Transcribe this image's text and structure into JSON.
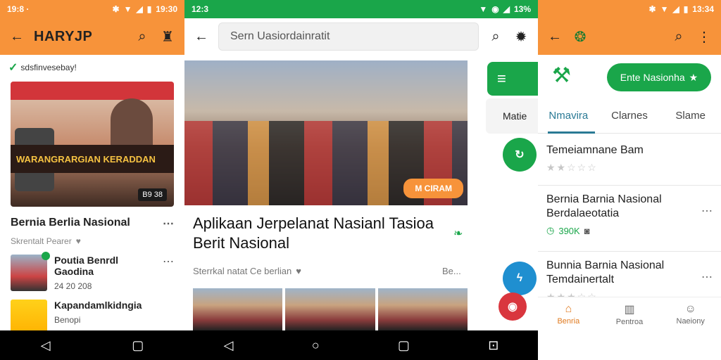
{
  "panel_a": {
    "status_time": "19:8 ·",
    "status_right": "19:30",
    "app_title": "HARYJP",
    "verified_text": "sdsfinvesebay!",
    "hero_banner": "WARANGRARGIAN KERADDAN",
    "hero_tag": "B9 38",
    "section_title": "Bernia Berlia Nasional",
    "meta_text": "Skrentalt Pearer",
    "items": [
      {
        "title": "Poutia Benrdl Gaodina",
        "sub": "24 20 208"
      },
      {
        "title": "Kapandamlkidngia",
        "sub": "Benopi"
      }
    ]
  },
  "panel_b": {
    "status_time": "12:3",
    "status_right": "13%",
    "search_placeholder": "Sern Uasiordainratit",
    "hero_pill": "M CIRAM",
    "side_label": "Matie",
    "title": "Aplikaan Jerpelanat Nasianl Tasioa Berit Nasional",
    "meta_text": "Sterrkal natat  Ce berlian",
    "more_text": "Be..."
  },
  "panel_c": {
    "status_right": "13:34",
    "cta_label": "Ente Nasionha",
    "tabs": [
      "Nmavira",
      "Clarnes",
      "Slame"
    ],
    "items": [
      {
        "title": "Temeiamnane Bam"
      },
      {
        "title": "Bernia Barnia Nasional Berdalaeotatia",
        "sub": "390K"
      },
      {
        "title": "Bunnia Barnia Nasional Temdainertalt"
      }
    ],
    "bottom_nav": [
      "Benria",
      "Pentroa",
      "Naeiony"
    ]
  }
}
